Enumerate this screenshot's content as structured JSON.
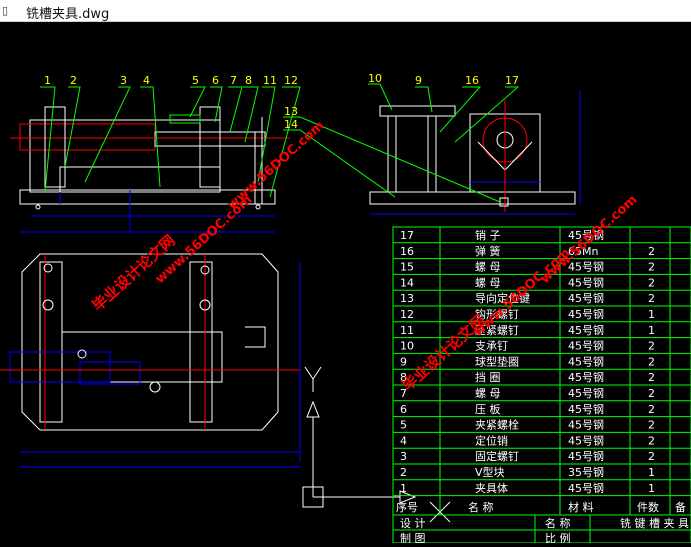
{
  "window": {
    "title": "铣槽夹具.dwg",
    "icon": "file-icon"
  },
  "balloons": [
    "1",
    "2",
    "3",
    "4",
    "5",
    "6",
    "7",
    "8",
    "11",
    "12",
    "13",
    "14",
    "10",
    "9",
    "16",
    "17"
  ],
  "bom": {
    "rows": [
      {
        "no": "17",
        "name": "销 子",
        "material": "45号钢",
        "qty": ""
      },
      {
        "no": "16",
        "name": "弹 簧",
        "material": "65Mn",
        "qty": "2"
      },
      {
        "no": "15",
        "name": "螺 母",
        "material": "45号钢",
        "qty": "2"
      },
      {
        "no": "14",
        "name": "螺 母",
        "material": "45号钢",
        "qty": "2"
      },
      {
        "no": "13",
        "name": "导向定位键",
        "material": "45号钢",
        "qty": "2"
      },
      {
        "no": "12",
        "name": "钩形螺钉",
        "material": "45号钢",
        "qty": "1"
      },
      {
        "no": "11",
        "name": "压紧螺钉",
        "material": "45号钢",
        "qty": "1"
      },
      {
        "no": "10",
        "name": "支承钉",
        "material": "45号钢",
        "qty": "2"
      },
      {
        "no": "9",
        "name": "球型垫圈",
        "material": "45号钢",
        "qty": "2"
      },
      {
        "no": "8",
        "name": "挡 圈",
        "material": "45号钢",
        "qty": "2"
      },
      {
        "no": "7",
        "name": "螺 母",
        "material": "45号钢",
        "qty": "2"
      },
      {
        "no": "6",
        "name": "压 板",
        "material": "45号钢",
        "qty": "2"
      },
      {
        "no": "5",
        "name": "夹紧螺栓",
        "material": "45号钢",
        "qty": "2"
      },
      {
        "no": "4",
        "name": "定位销",
        "material": "45号钢",
        "qty": "2"
      },
      {
        "no": "3",
        "name": "固定螺钉",
        "material": "45号钢",
        "qty": "2"
      },
      {
        "no": "2",
        "name": "V型块",
        "material": "35号钢",
        "qty": "1"
      },
      {
        "no": "1",
        "name": "夹具体",
        "material": "45号钢",
        "qty": "1"
      }
    ],
    "header": {
      "no": "序号",
      "name": "名 称",
      "material": "材 料",
      "qty": "件数",
      "note": "备"
    },
    "title_block": {
      "design": "设 计",
      "name_label": "名 称",
      "name_value": "铣 键 槽 夹 具",
      "draw": "制 图",
      "scale": "比 例"
    }
  },
  "watermarks": [
    {
      "text": "毕业设计论文网"
    },
    {
      "text": "www.56DOC.com"
    }
  ],
  "colors": {
    "background": "#000000",
    "outline": "#ffffff",
    "hidden": "#0000ff",
    "center": "#ff0000",
    "leader": "#00ff00",
    "table": "#00ff00",
    "watermark": "#ff0000",
    "annotation": "#ffff00"
  }
}
